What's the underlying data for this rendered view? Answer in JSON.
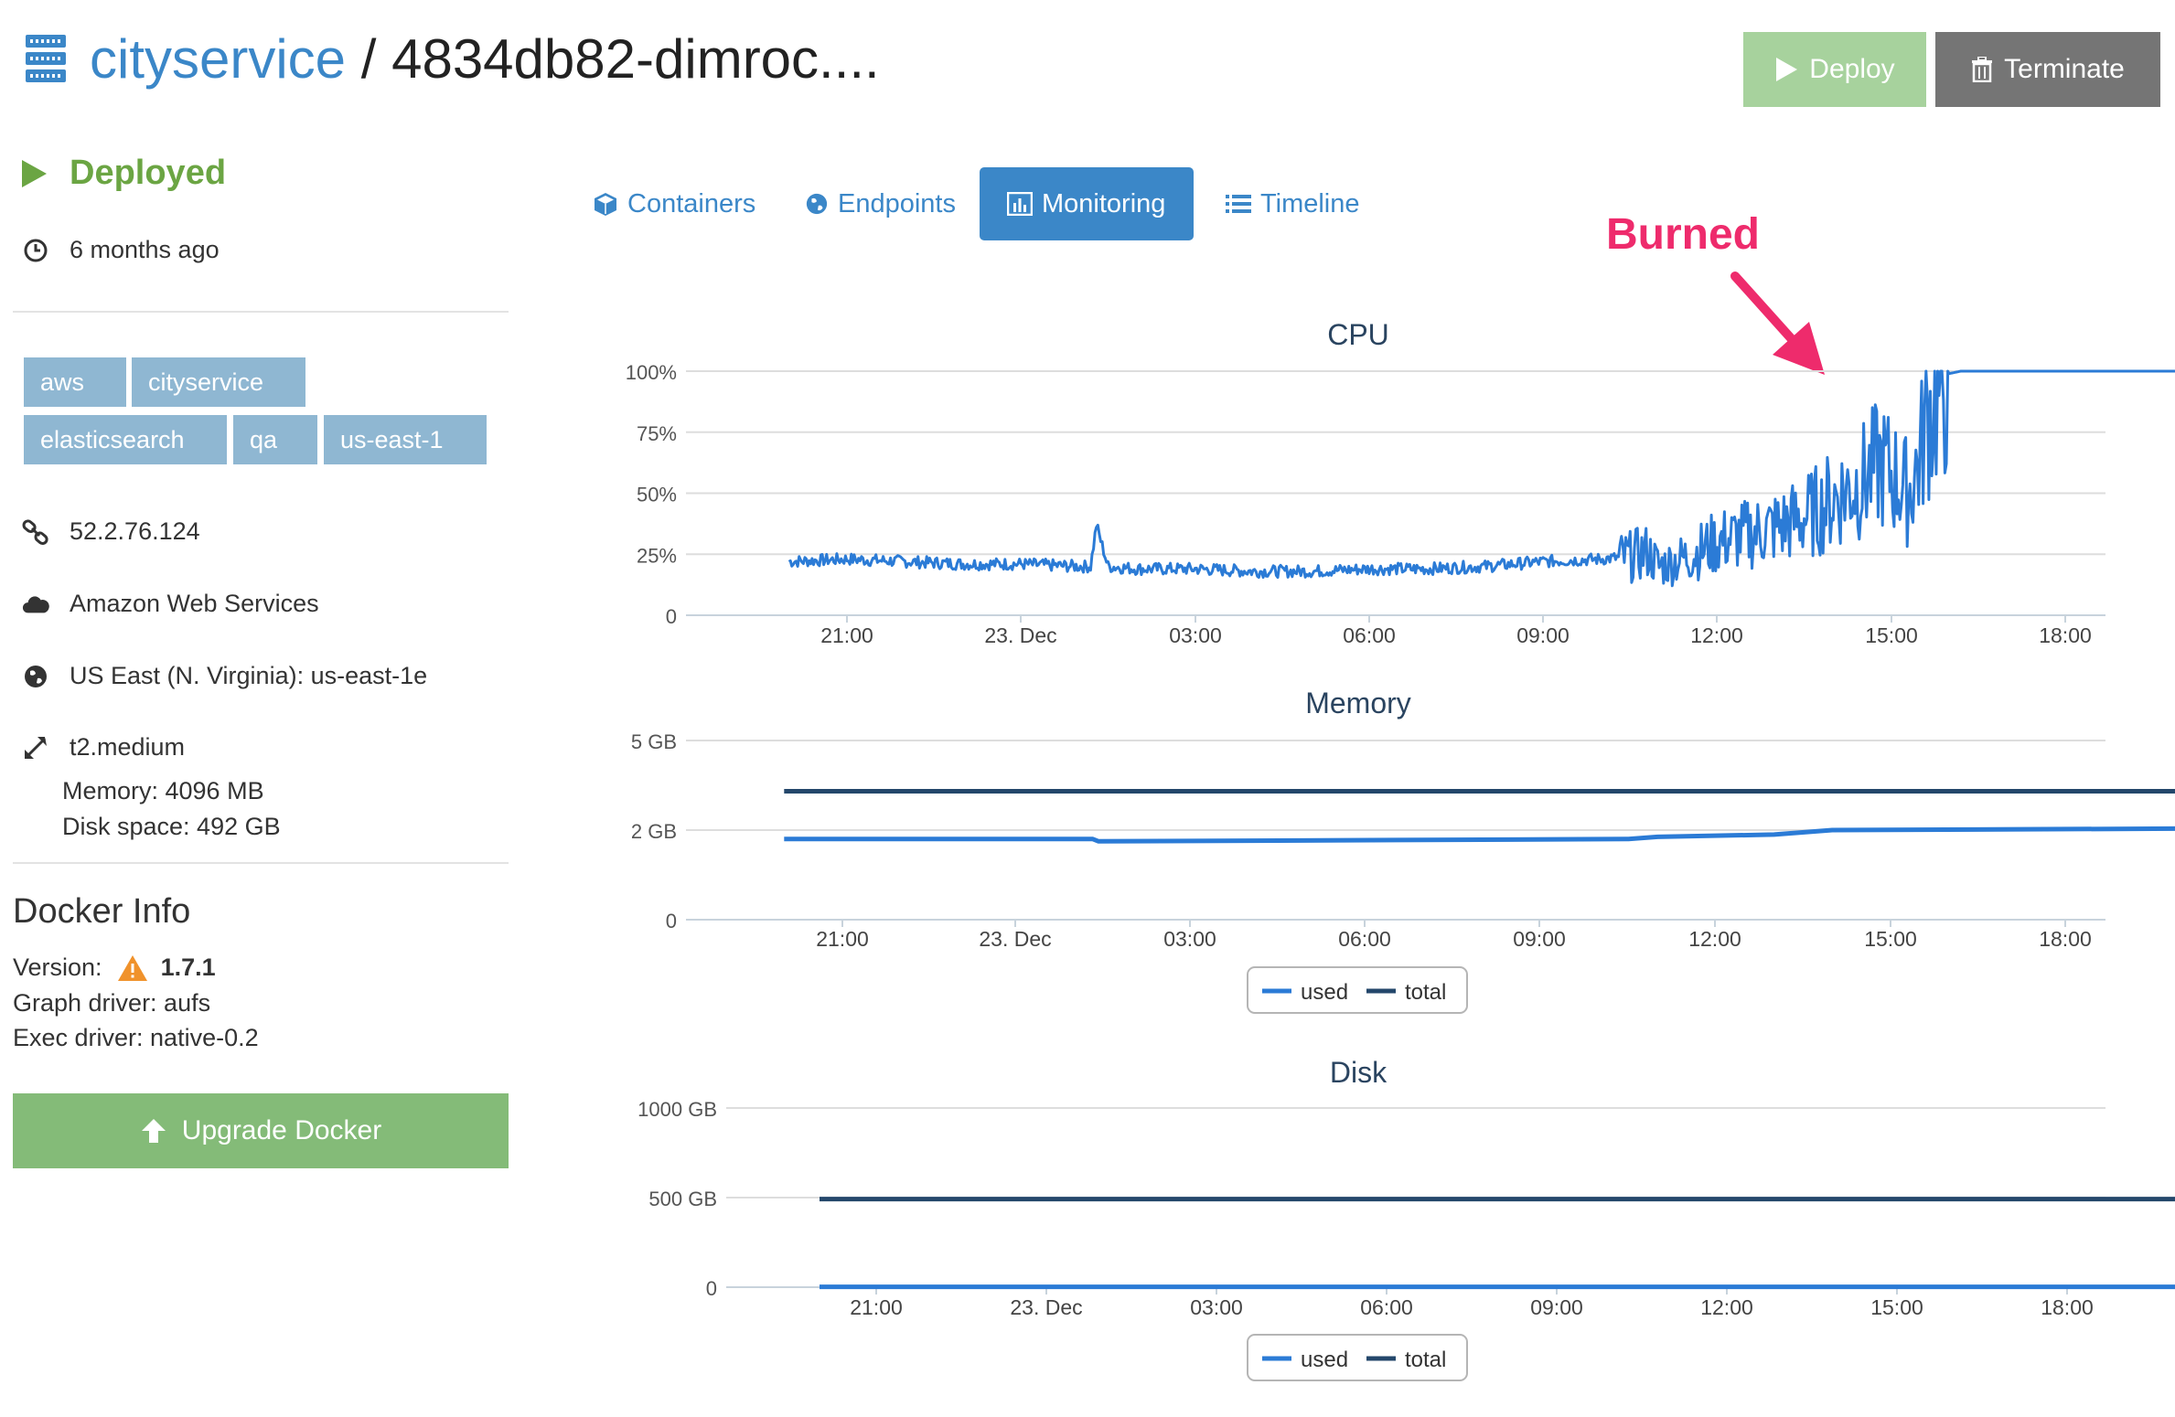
{
  "header": {
    "project": "cityservice",
    "separator": " / ",
    "node": "4834db82-dimroc....",
    "deploy_label": "Deploy",
    "terminate_label": "Terminate"
  },
  "sidebar": {
    "status": "Deployed",
    "age": "6 months ago",
    "tags": [
      "aws",
      "cityservice",
      "elasticsearch",
      "qa",
      "us-east-1"
    ],
    "ip": "52.2.76.124",
    "provider": "Amazon Web Services",
    "region": "US East (N. Virginia): us-east-1e",
    "size": "t2.medium",
    "memory": "Memory: 4096 MB",
    "disk": "Disk space: 492 GB",
    "docker": {
      "heading": "Docker Info",
      "version_label": "Version:",
      "version": "1.7.1",
      "graph_driver": "Graph driver: aufs",
      "exec_driver": "Exec driver: native-0.2",
      "upgrade_label": "Upgrade Docker"
    }
  },
  "tabs": [
    {
      "label": "Containers",
      "icon": "cube-icon",
      "active": false
    },
    {
      "label": "Endpoints",
      "icon": "globe-icon",
      "active": false
    },
    {
      "label": "Monitoring",
      "icon": "bar-chart-icon",
      "active": true
    },
    {
      "label": "Timeline",
      "icon": "list-icon",
      "active": false
    }
  ],
  "annotation": {
    "text": "Burned",
    "color": "#ee2b6c"
  },
  "colors": {
    "used": "#2b7bd6",
    "total": "#24476b",
    "accent": "#3b87c8",
    "deployed": "#6ba543"
  },
  "chart_data": [
    {
      "type": "line",
      "title": "CPU",
      "x_ticks": [
        "21:00",
        "23. Dec",
        "03:00",
        "06:00",
        "09:00",
        "12:00",
        "15:00",
        "18:00"
      ],
      "y_ticks": [
        "100%",
        "75%",
        "50%",
        "25%",
        "0"
      ],
      "ylim": [
        0,
        100
      ],
      "x_unit": "hours since 18:00 (22 Dec)",
      "xlim": [
        1.7,
        26.3
      ],
      "series": [
        {
          "key": "cpu",
          "x": [
            2,
            3,
            4,
            5,
            6,
            7,
            7.2,
            7.3,
            7.5,
            8,
            9,
            10,
            11,
            12,
            13,
            14,
            15,
            16,
            16.5,
            16.8,
            17,
            17.5,
            18,
            18.5,
            19,
            19.5,
            19.8,
            20,
            20.5,
            20.8,
            21,
            21.3,
            21.5,
            21.6,
            22,
            22.2,
            23,
            24,
            25,
            26
          ],
          "y": [
            22,
            23,
            22,
            21,
            21,
            20,
            20,
            37,
            20,
            19,
            19,
            18,
            18,
            19,
            19,
            20,
            22,
            23,
            24,
            26,
            20,
            24,
            30,
            33,
            36,
            40,
            44,
            48,
            55,
            62,
            58,
            50,
            65,
            80,
            99,
            100,
            100,
            100,
            100,
            100
          ],
          "noise": true
        }
      ]
    },
    {
      "type": "line",
      "title": "Memory",
      "x_ticks": [
        "21:00",
        "23. Dec",
        "03:00",
        "06:00",
        "09:00",
        "12:00",
        "15:00",
        "18:00"
      ],
      "y_ticks": [
        "5 GB",
        "2 GB",
        "0"
      ],
      "legend": [
        "used",
        "total"
      ],
      "series": [
        {
          "name": "used",
          "x": [
            2,
            7.3,
            7.4,
            16.5,
            17,
            19,
            20,
            26
          ],
          "y": [
            1.8,
            1.8,
            1.75,
            1.8,
            1.85,
            1.9,
            2.0,
            2.05
          ]
        },
        {
          "name": "total",
          "x": [
            2,
            26
          ],
          "y": [
            3.3,
            3.3
          ]
        }
      ]
    },
    {
      "type": "line",
      "title": "Disk",
      "x_ticks": [
        "21:00",
        "23. Dec",
        "03:00",
        "06:00",
        "09:00",
        "12:00",
        "15:00",
        "18:00"
      ],
      "y_ticks": [
        "1000 GB",
        "500 GB",
        "0"
      ],
      "legend": [
        "used",
        "total"
      ],
      "series": [
        {
          "name": "used",
          "x": [
            2,
            26
          ],
          "y": [
            2,
            2
          ]
        },
        {
          "name": "total",
          "x": [
            2,
            26
          ],
          "y": [
            492,
            492
          ]
        }
      ]
    }
  ]
}
